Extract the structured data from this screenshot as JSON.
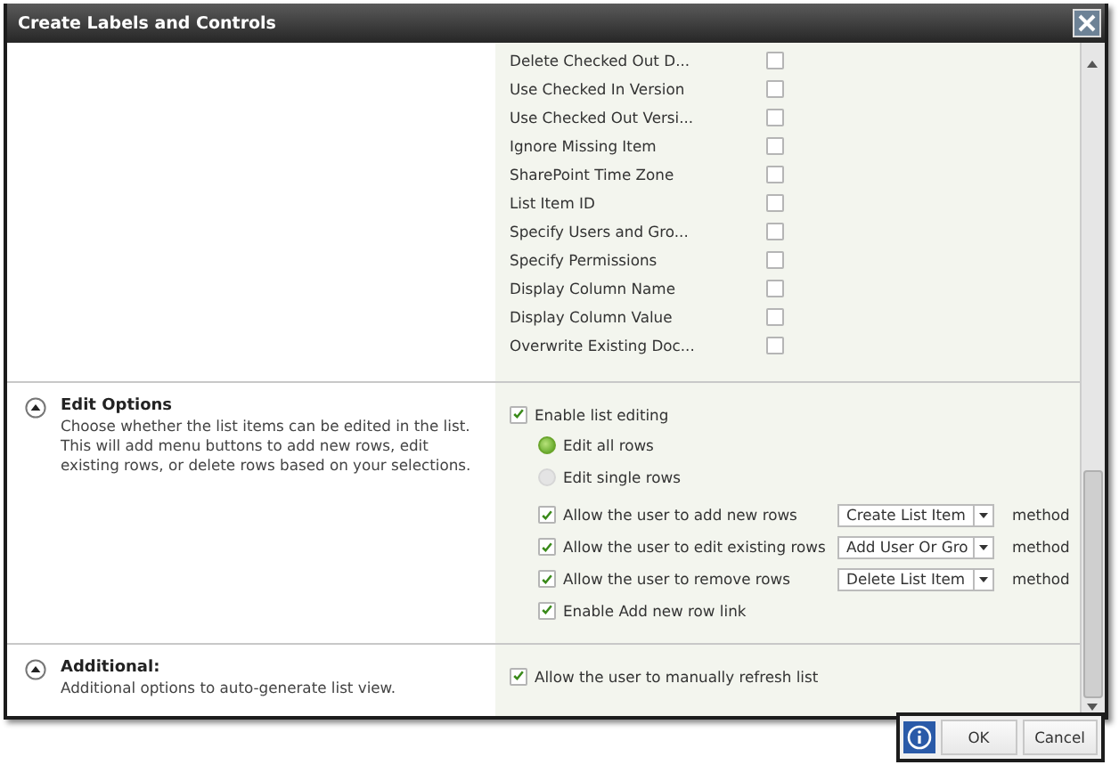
{
  "window": {
    "title": "Create Labels and Controls"
  },
  "field_options": [
    {
      "label": "Delete Checked Out D...",
      "checked": false
    },
    {
      "label": "Use Checked In Version",
      "checked": false
    },
    {
      "label": "Use Checked Out Versi...",
      "checked": false
    },
    {
      "label": "Ignore Missing Item",
      "checked": false
    },
    {
      "label": "SharePoint Time Zone",
      "checked": false
    },
    {
      "label": "List Item ID",
      "checked": false
    },
    {
      "label": "Specify Users and Gro...",
      "checked": false
    },
    {
      "label": "Specify Permissions",
      "checked": false
    },
    {
      "label": "Display Column Name",
      "checked": false
    },
    {
      "label": "Display Column Value",
      "checked": false
    },
    {
      "label": "Overwrite Existing Doc...",
      "checked": false
    }
  ],
  "edit_options": {
    "title": "Edit Options",
    "expanded": true,
    "description": "Choose whether the list items can be edited in the list. This will add menu buttons to add new rows, edit existing rows, or delete rows based on your selections.",
    "enable_list_editing": {
      "label": "Enable list editing",
      "checked": true
    },
    "edit_modes": [
      {
        "label": "Edit all rows",
        "selected": true
      },
      {
        "label": "Edit single rows",
        "selected": false
      }
    ],
    "permissions": [
      {
        "label": "Allow the user to add new rows",
        "checked": true,
        "method": "Create List Item",
        "suffix": "method"
      },
      {
        "label": "Allow the user to edit existing rows",
        "checked": true,
        "method": "Add User Or Gro",
        "suffix": "method"
      },
      {
        "label": "Allow the user to remove rows",
        "checked": true,
        "method": "Delete List Item",
        "suffix": "method"
      }
    ],
    "add_row_link": {
      "label": "Enable Add new row link",
      "checked": true
    }
  },
  "additional": {
    "title": "Additional:",
    "expanded": true,
    "description": "Additional options to auto-generate list view.",
    "manual_refresh": {
      "label": "Allow the user to manually refresh list",
      "checked": true
    }
  },
  "buttons": [
    {
      "label": "OK"
    },
    {
      "label": "Cancel"
    }
  ]
}
